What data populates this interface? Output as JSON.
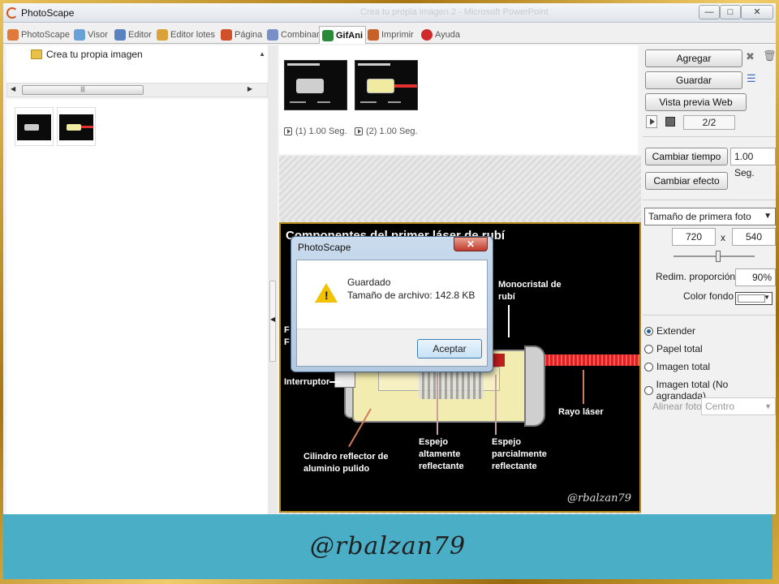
{
  "window": {
    "title": "PhotoScape",
    "ghost_title": "Crea tu propia imagen 2 - Microsoft PowerPoint"
  },
  "tabs": [
    {
      "label": "PhotoScape",
      "color": "#3a7bd5"
    },
    {
      "label": "Visor",
      "color": "#3a7bd5"
    },
    {
      "label": "Editor",
      "color": "#3a7bd5"
    },
    {
      "label": "Editor lotes",
      "color": "#3a7bd5"
    },
    {
      "label": "Página",
      "color": "#d0502a"
    },
    {
      "label": "Combinar",
      "color": "#3a7bd5"
    },
    {
      "label": "GifAni",
      "color": "#2a8a3a"
    },
    {
      "label": "Imprimir",
      "color": "#d0502a"
    },
    {
      "label": "Ayuda",
      "color": "#d02a2a"
    }
  ],
  "active_tab": "GifAni",
  "tree": {
    "folder": "Crea tu propia imagen"
  },
  "frames": [
    {
      "label": "(1) 1.00 Seg."
    },
    {
      "label": "(2) 1.00 Seg."
    }
  ],
  "slide": {
    "title": "Componentes del primer láser de rubí",
    "labels": {
      "monocristal": "Monocristal de rubí",
      "interruptor": "Interruptor",
      "rayo": "Rayo láser",
      "cilindro": "Cilindro reflector de aluminio pulido",
      "espejo_alto": "Espejo altamente reflectante",
      "espejo_parcial": "Espejo parcialmente reflectante",
      "left_partial": "F F"
    },
    "watermark": "@rbalzan79"
  },
  "dialog": {
    "title": "PhotoScape",
    "close": "✕",
    "line1": "Guardado",
    "line2": "Tamaño de archivo: 142.8 KB",
    "ok": "Aceptar"
  },
  "right_panel": {
    "agregar": "Agregar",
    "guardar": "Guardar",
    "vista_previa": "Vista previa Web",
    "counter": "2/2",
    "cambiar_tiempo": "Cambiar tiempo",
    "tiempo_value": "1.00 Seg.",
    "cambiar_efecto": "Cambiar efecto",
    "size_mode": "Tamaño de primera foto",
    "width": "720",
    "x": "x",
    "height": "540",
    "redim_label": "Redim. proporción",
    "redim_value": "90%",
    "color_label": "Color fondo",
    "options": [
      "Extender",
      "Papel total",
      "Imagen total",
      "Imagen total (No agrandada)"
    ],
    "selected_option": "Extender",
    "align_label": "Alinear foto",
    "align_value": "Centro"
  },
  "footer": {
    "signature": "@rbalzan79"
  },
  "colors": {
    "teal": "#4aaec6",
    "gold": "#c89a1e",
    "laser": "#e02020"
  }
}
